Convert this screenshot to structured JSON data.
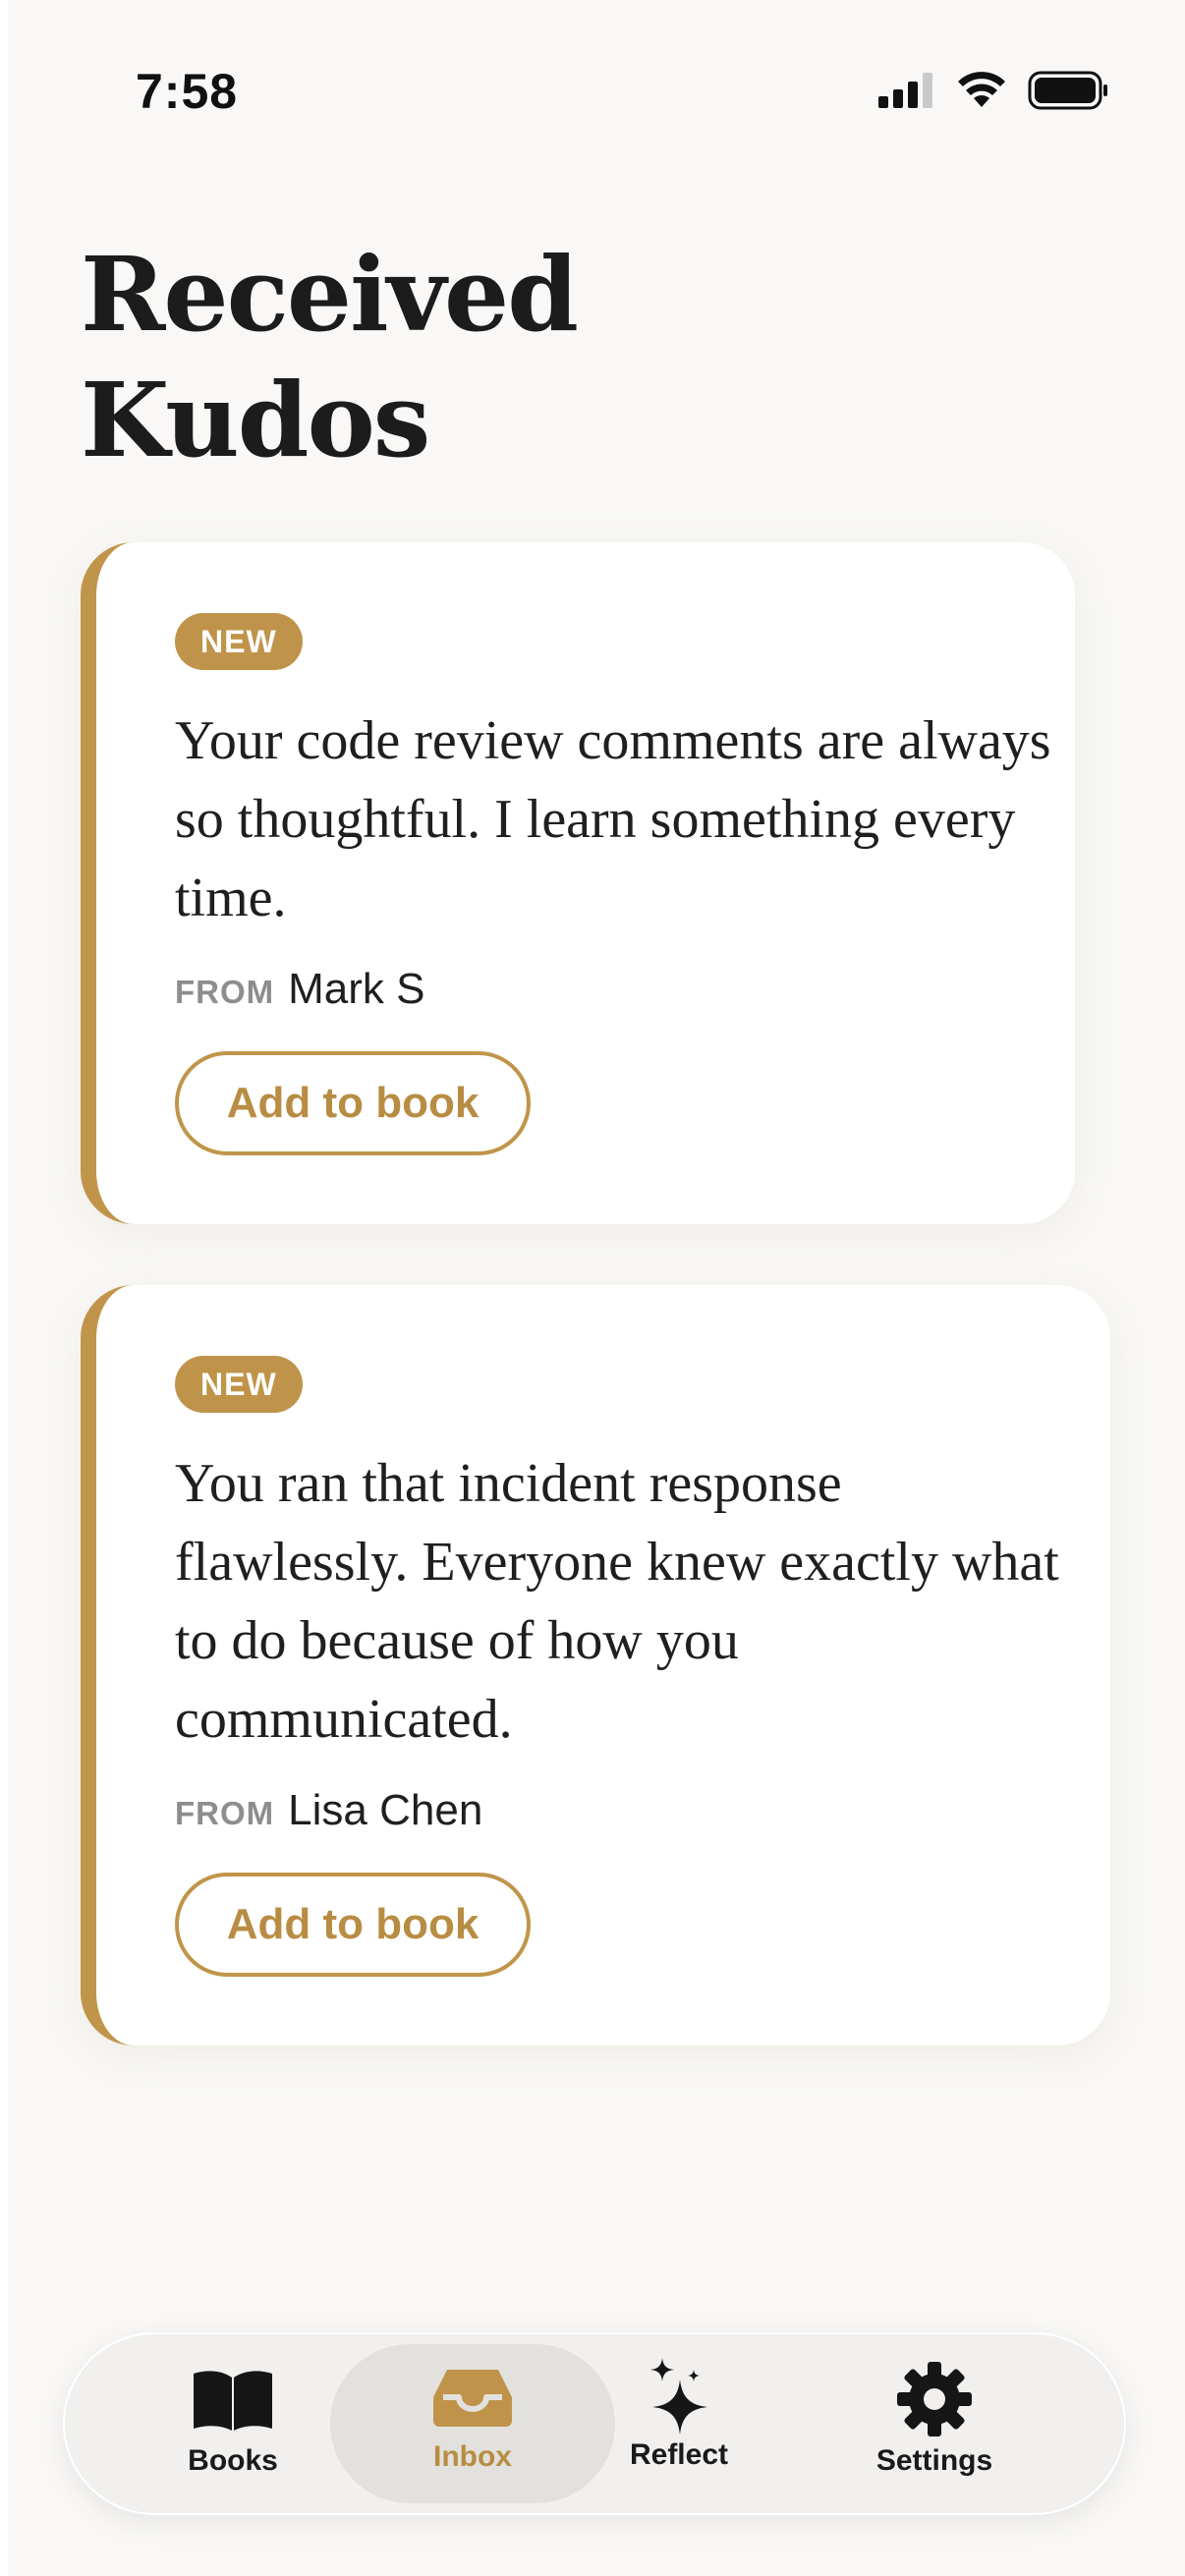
{
  "status_bar": {
    "time": "7:58"
  },
  "page": {
    "title": "Received\nKudos"
  },
  "cards": [
    {
      "badge": "NEW",
      "message": "Your code review comments are always so thoughtful. I learn something every time.",
      "from_label": "FROM",
      "from_name": "Mark S",
      "button_label": "Add to book"
    },
    {
      "badge": "NEW",
      "message": "You ran that incident response flawlessly. Everyone knew exactly what to do because of how you communicated.",
      "from_label": "FROM",
      "from_name": "Lisa Chen",
      "button_label": "Add to book"
    }
  ],
  "tabbar": {
    "items": [
      {
        "label": "Books",
        "icon": "book-icon"
      },
      {
        "label": "Inbox",
        "icon": "inbox-icon",
        "active": true
      },
      {
        "label": "Reflect",
        "icon": "sparkles-icon"
      },
      {
        "label": "Settings",
        "icon": "gear-icon"
      }
    ]
  },
  "colors": {
    "accent": "#c0954a",
    "background": "#f9f8f6",
    "card": "#ffffff",
    "text": "#1c1c1c",
    "muted": "#8d8d8d"
  }
}
